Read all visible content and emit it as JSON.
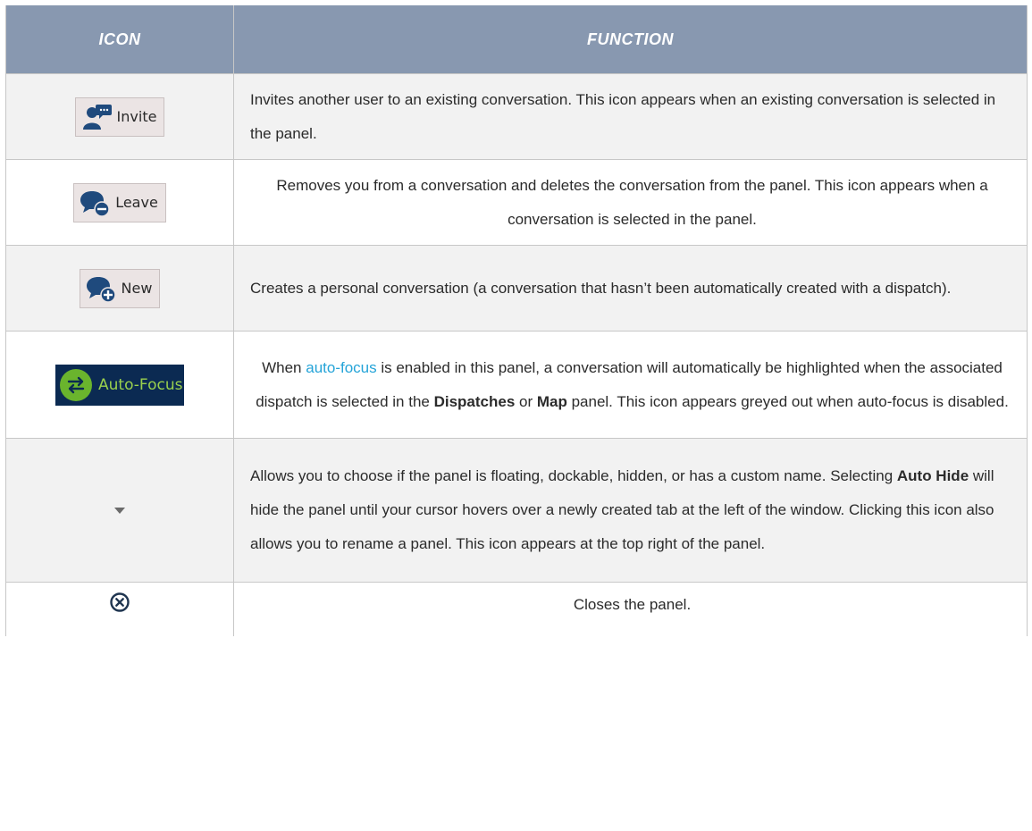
{
  "header": {
    "col_icon": "ICON",
    "col_function": "FUNCTION"
  },
  "rows": [
    {
      "icon_label": "Invite",
      "text": "Invites another user to an existing conversation. This icon appears when an existing conversation is selected in the panel."
    },
    {
      "icon_label": "Leave",
      "text": "Removes you from a conversation and deletes the conversation from the panel. This icon appears when a conversation is selected in the panel."
    },
    {
      "icon_label": "New",
      "text": "Creates a personal conversation (a conversation that hasn’t been automatically created with a dispatch)."
    },
    {
      "icon_label": "Auto-Focus",
      "text_pre": "When ",
      "link": "auto-focus",
      "text_mid": " is enabled in this panel, a conversation will automatically be highlighted when the associated dispatch is selected in the ",
      "bold1": "Dispatches",
      "text_or": " or ",
      "bold2": "Map",
      "text_post": " panel. This icon appears greyed out when auto-focus is disabled."
    },
    {
      "icon_label": "",
      "text_pre": "Allows you to choose if the panel is floating, dockable, hidden, or has a custom name. Selecting ",
      "bold1": "Auto Hide",
      "text_post": " will hide the panel until your cursor hovers over a newly created tab at the left of the window. Clicking this icon also allows you to rename a panel. This icon appears at the top right of the panel."
    },
    {
      "icon_label": "",
      "text": "Closes the panel."
    }
  ],
  "colors": {
    "header_bg": "#8898b0",
    "link": "#25a4d8",
    "autofocus_bg": "#0b2a52",
    "autofocus_green": "#6ab42d"
  },
  "icons": [
    "invite-icon",
    "leave-icon",
    "new-icon",
    "autofocus-icon",
    "dropdown-caret-icon",
    "close-circle-icon"
  ]
}
